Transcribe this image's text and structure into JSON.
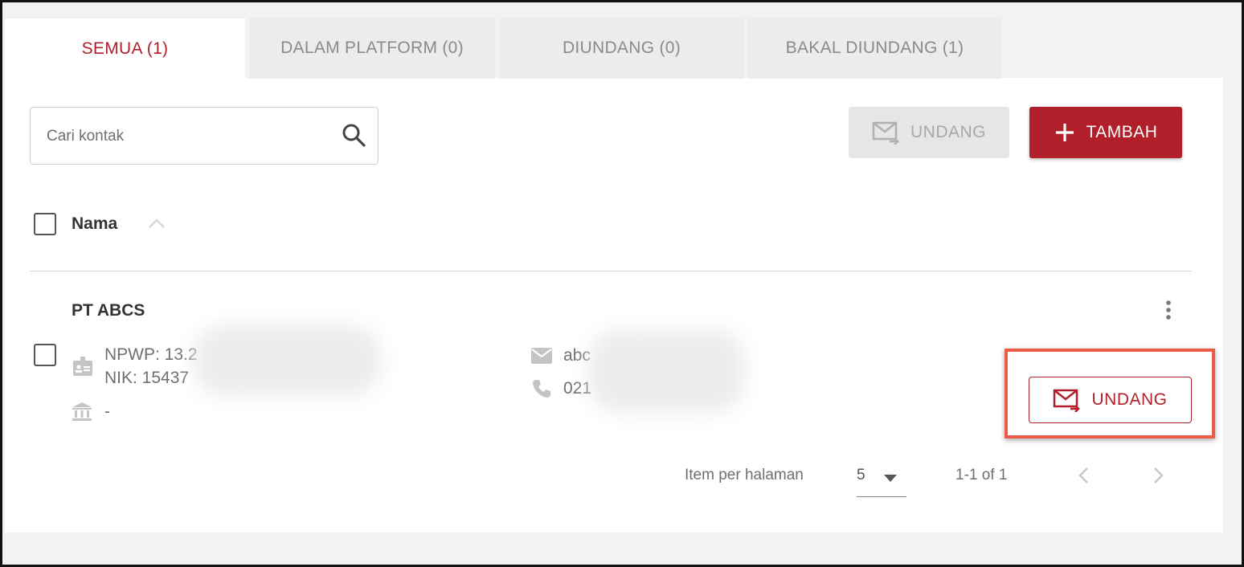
{
  "tabs": [
    {
      "label": "SEMUA (1)",
      "active": true
    },
    {
      "label": "DALAM PLATFORM (0)",
      "active": false
    },
    {
      "label": "DIUNDANG (0)",
      "active": false
    },
    {
      "label": "BAKAL DIUNDANG (1)",
      "active": false
    }
  ],
  "search": {
    "placeholder": "Cari kontak",
    "value": ""
  },
  "toolbar": {
    "invite_label": "UNDANG",
    "add_label": "TAMBAH"
  },
  "table": {
    "header": "Nama"
  },
  "contact": {
    "name": "PT ABCS",
    "npwp": "NPWP: 13.2",
    "nik": "NIK: 15437",
    "bank": "-",
    "email": "abc",
    "phone": "021",
    "invite_label": "UNDANG"
  },
  "pagination": {
    "items_per_page_label": "Item per halaman",
    "items_per_page": "5",
    "range": "1-1 of 1"
  },
  "colors": {
    "accent": "#b01f2a",
    "highlight": "#ee5c48"
  }
}
